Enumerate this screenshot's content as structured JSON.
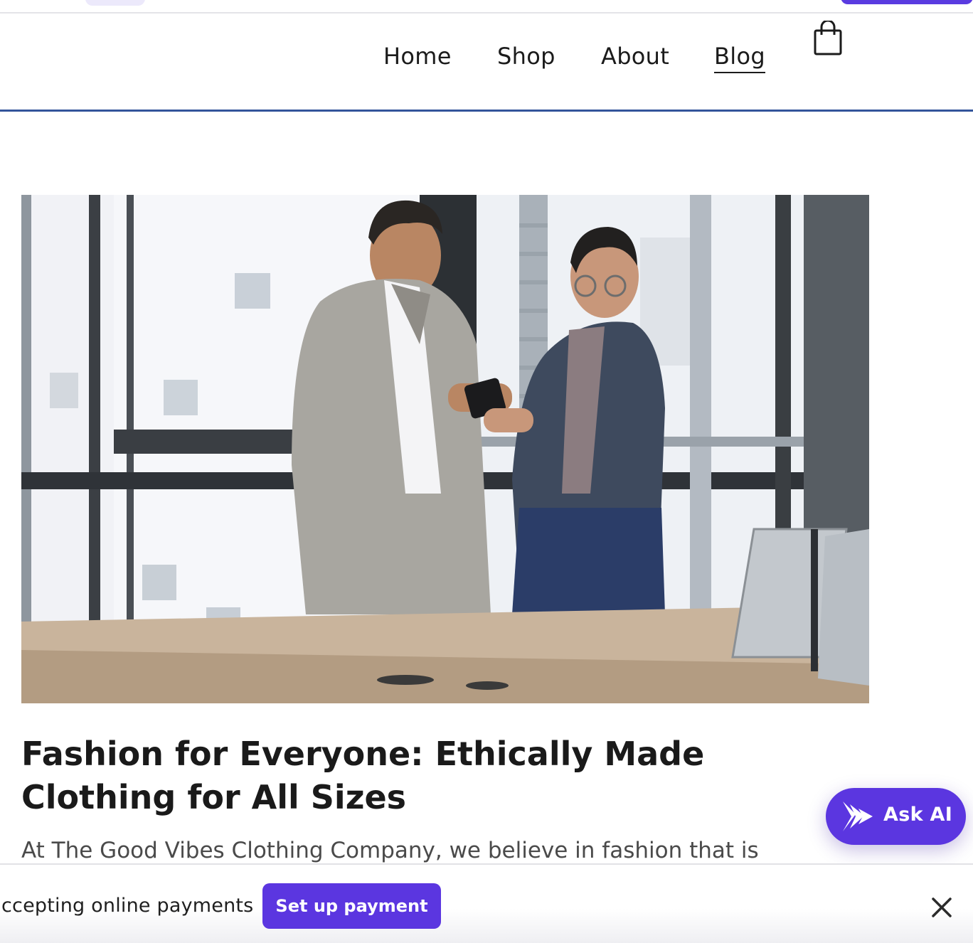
{
  "nav": {
    "items": [
      {
        "label": "Home",
        "active": false
      },
      {
        "label": "Shop",
        "active": false
      },
      {
        "label": "About",
        "active": false
      },
      {
        "label": "Blog",
        "active": true
      }
    ],
    "cart_icon": "shopping-bag-icon"
  },
  "post": {
    "title": "Fashion for Everyone: Ethically Made Clothing for All Sizes",
    "excerpt": "At The Good Vibes Clothing Company, we believe in fashion that is"
  },
  "ask_ai": {
    "label": "Ask AI",
    "icon": "ai-sparkle-icon"
  },
  "payment_bar": {
    "message": "ccepting online payments",
    "button_label": "Set up payment",
    "close_icon": "close-icon"
  },
  "colors": {
    "accent": "#5b36e0",
    "header_rule": "#33549b",
    "text": "#1a1a1a"
  }
}
